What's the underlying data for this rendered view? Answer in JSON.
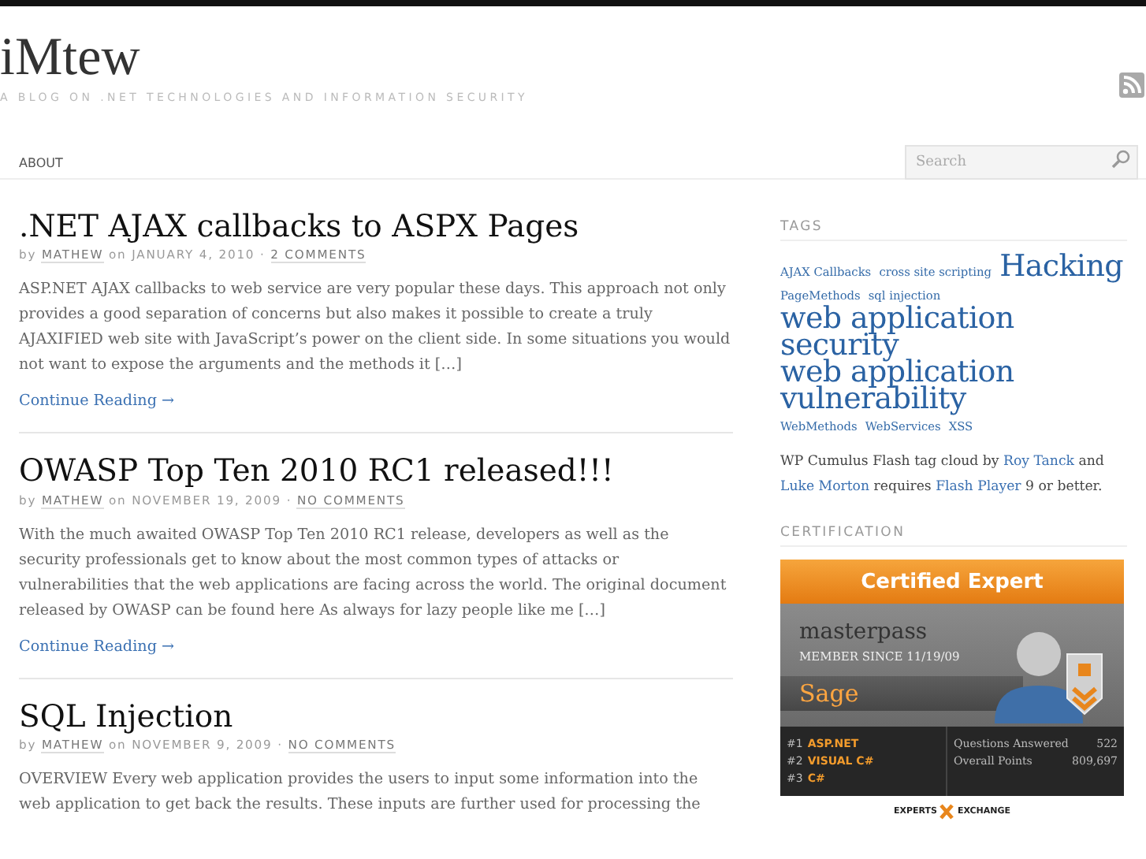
{
  "header": {
    "title": "iMtew",
    "tagline": "A BLOG ON .NET TECHNOLOGIES AND INFORMATION SECURITY"
  },
  "nav": {
    "items": [
      {
        "label": "ABOUT"
      }
    ],
    "search": {
      "placeholder": "Search"
    }
  },
  "posts": [
    {
      "title": ".NET AJAX callbacks to ASPX Pages",
      "by_label": "by",
      "author": "MATHEW",
      "on_label": "on",
      "date": "JANUARY 4, 2010",
      "separator": "·",
      "comments": "2 COMMENTS",
      "excerpt": "ASP.NET AJAX callbacks to web service are very popular these days. This approach not only provides a good separation of concerns but also makes it possible to create a truly AJAXIFIED web site with JavaScript’s power on the client side. In some situations you would not want to expose the arguments and the methods it […]",
      "more": "Continue Reading →"
    },
    {
      "title": "OWASP Top Ten 2010 RC1 released!!!",
      "by_label": "by",
      "author": "MATHEW",
      "on_label": "on",
      "date": "NOVEMBER 19, 2009",
      "separator": "·",
      "comments": "NO COMMENTS",
      "excerpt": "With the much awaited OWASP Top Ten 2010 RC1 release, developers as well as the security professionals get to know about the most common types of attacks or vulnerabilities that the web applications are facing across the world. The original document released by OWASP can be found here As always for lazy people like me […]",
      "more": "Continue Reading →"
    },
    {
      "title": "SQL Injection",
      "by_label": "by",
      "author": "MATHEW",
      "on_label": "on",
      "date": "NOVEMBER 9, 2009",
      "separator": "·",
      "comments": "NO COMMENTS",
      "excerpt": "OVERVIEW Every web application provides the users to input some information into the web application to get back the results. These inputs are further used for processing the"
    }
  ],
  "sidebar": {
    "tags_heading": "TAGS",
    "tags": [
      {
        "label": "AJAX Callbacks",
        "kind": "small"
      },
      {
        "label": "cross site scripting",
        "kind": "small"
      },
      {
        "label": "Hacking",
        "kind": "large"
      },
      {
        "label": "PageMethods",
        "kind": "small"
      },
      {
        "label": "sql injection",
        "kind": "small"
      },
      {
        "label": "web application security",
        "kind": "large"
      },
      {
        "label": "web application vulnerability",
        "kind": "large"
      },
      {
        "label": "WebMethods",
        "kind": "small"
      },
      {
        "label": "WebServices",
        "kind": "small"
      },
      {
        "label": "XSS",
        "kind": "small"
      }
    ],
    "note": [
      {
        "text": "WP Cumulus Flash tag cloud by ",
        "kind": "text"
      },
      {
        "text": "Roy Tanck",
        "kind": "link"
      },
      {
        "text": " and ",
        "kind": "text"
      },
      {
        "text": "Luke Morton",
        "kind": "link"
      },
      {
        "text": " requires ",
        "kind": "text"
      },
      {
        "text": "Flash Player",
        "kind": "link"
      },
      {
        "text": " 9 or better.",
        "kind": "text"
      }
    ],
    "cert_heading": "CERTIFICATION",
    "badge": {
      "title": "Certified Expert",
      "username": "masterpass",
      "member_since": "MEMBER SINCE 11/19/09",
      "level": "Sage",
      "ranks": [
        {
          "rank": "#1",
          "topic": "ASP.NET"
        },
        {
          "rank": "#2",
          "topic": "VISUAL C#"
        },
        {
          "rank": "#3",
          "topic": "C#"
        }
      ],
      "stats": [
        {
          "label": "Questions Answered",
          "value": "522"
        },
        {
          "label": "Overall Points",
          "value": "809,697"
        }
      ],
      "brand_left": "EXPERTS",
      "brand_right": "EXCHANGE"
    }
  }
}
